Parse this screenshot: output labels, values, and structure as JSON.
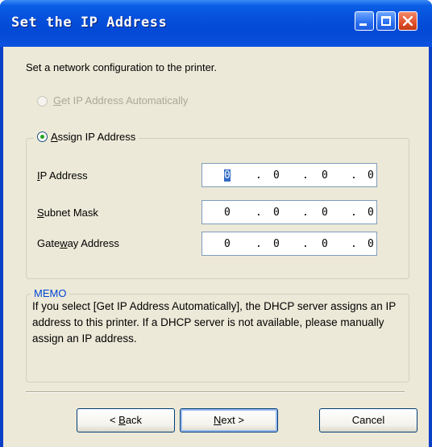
{
  "window": {
    "title": "Set the IP Address"
  },
  "intro_text": "Set a network configuration to the printer.",
  "options": {
    "auto": {
      "prefix": "",
      "accel": "G",
      "rest": "et IP Address Automatically",
      "checked": false,
      "enabled": false
    },
    "assign": {
      "prefix": "",
      "accel": "A",
      "rest": "ssign IP Address",
      "checked": true,
      "enabled": true
    }
  },
  "fields": [
    {
      "label_accel": "I",
      "label_rest": "P Address",
      "label_pre": "",
      "octets": [
        "0",
        "0",
        "0",
        "0"
      ]
    },
    {
      "label_accel": "S",
      "label_rest": "ubnet Mask",
      "label_pre": "",
      "octets": [
        "0",
        "0",
        "0",
        "0"
      ]
    },
    {
      "label_pre": "Gate",
      "label_accel": "w",
      "label_rest": "ay Address",
      "octets": [
        "0",
        "0",
        "0",
        "0"
      ]
    }
  ],
  "memo": {
    "title": "MEMO",
    "text": "If you select [Get IP Address Automatically], the DHCP server assigns an IP address to this printer. If a DHCP server is not available, please manually assign an IP address."
  },
  "buttons": {
    "back": {
      "pre": "< ",
      "accel": "B",
      "rest": "ack"
    },
    "next": {
      "pre": "",
      "accel": "N",
      "rest": "ext >"
    },
    "cancel": {
      "label": "Cancel"
    }
  },
  "colors": {
    "titlebar": "#0550dc",
    "dialog_bg": "#ece9d8",
    "memo_title": "#0046d5",
    "radio_dot": "#21a121"
  }
}
